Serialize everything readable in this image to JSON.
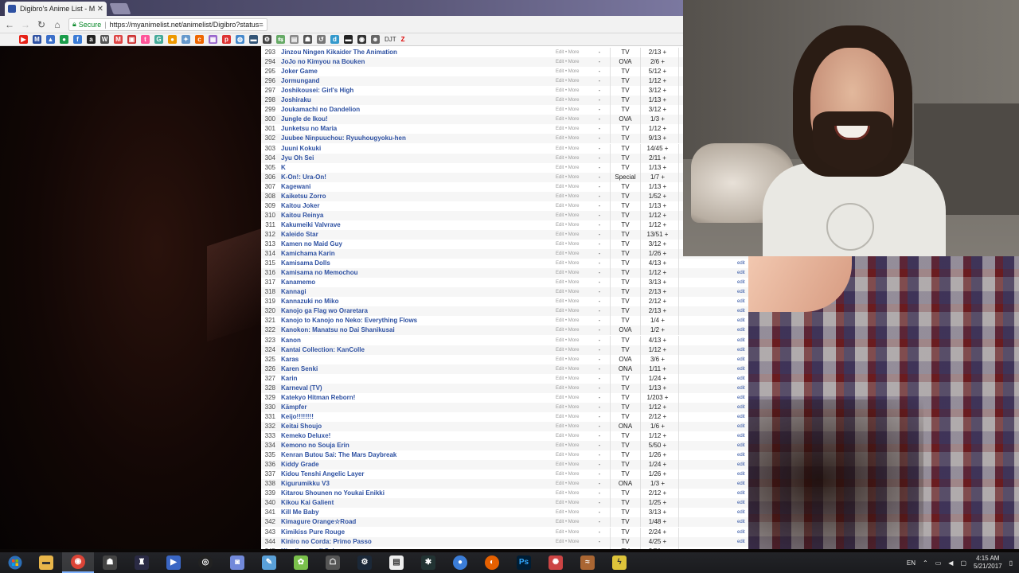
{
  "browser": {
    "tab_title": "Digibro's Anime List - M",
    "secure_label": "Secure",
    "url": "https://myanimelist.net/animelist/Digibro?status=4&tag="
  },
  "bookmarks": {
    "djt": "DJT",
    "z": "Z"
  },
  "list": {
    "edit_more": "Edit • More",
    "edit": "edit",
    "rows": [
      {
        "num": "293",
        "title": "Jinzou Ningen Kikaider The Animation",
        "score": "-",
        "type": "TV",
        "progress": "2/13 +"
      },
      {
        "num": "294",
        "title": "JoJo no Kimyou na Bouken",
        "score": "-",
        "type": "OVA",
        "progress": "2/6 +"
      },
      {
        "num": "295",
        "title": "Joker Game",
        "score": "-",
        "type": "TV",
        "progress": "5/12 +"
      },
      {
        "num": "296",
        "title": "Jormungand",
        "score": "-",
        "type": "TV",
        "progress": "1/12 +"
      },
      {
        "num": "297",
        "title": "Joshikousei: Girl's High",
        "score": "-",
        "type": "TV",
        "progress": "3/12 +"
      },
      {
        "num": "298",
        "title": "Joshiraku",
        "score": "-",
        "type": "TV",
        "progress": "1/13 +"
      },
      {
        "num": "299",
        "title": "Joukamachi no Dandelion",
        "score": "-",
        "type": "TV",
        "progress": "3/12 +"
      },
      {
        "num": "300",
        "title": "Jungle de Ikou!",
        "score": "-",
        "type": "OVA",
        "progress": "1/3 +"
      },
      {
        "num": "301",
        "title": "Junketsu no Maria",
        "score": "-",
        "type": "TV",
        "progress": "1/12 +"
      },
      {
        "num": "302",
        "title": "Juubee Ninpuuchou: Ryuuhougyoku-hen",
        "score": "-",
        "type": "TV",
        "progress": "9/13 +"
      },
      {
        "num": "303",
        "title": "Juuni Kokuki",
        "score": "-",
        "type": "TV",
        "progress": "14/45 +"
      },
      {
        "num": "304",
        "title": "Jyu Oh Sei",
        "score": "-",
        "type": "TV",
        "progress": "2/11 +"
      },
      {
        "num": "305",
        "title": "K",
        "score": "-",
        "type": "TV",
        "progress": "1/13 +"
      },
      {
        "num": "306",
        "title": "K-On!: Ura-On!",
        "score": "-",
        "type": "Special",
        "progress": "1/7 +"
      },
      {
        "num": "307",
        "title": "Kagewani",
        "score": "-",
        "type": "TV",
        "progress": "1/13 +"
      },
      {
        "num": "308",
        "title": "Kaiketsu Zorro",
        "score": "-",
        "type": "TV",
        "progress": "1/52 +"
      },
      {
        "num": "309",
        "title": "Kaitou Joker",
        "score": "-",
        "type": "TV",
        "progress": "1/13 +"
      },
      {
        "num": "310",
        "title": "Kaitou Reinya",
        "score": "-",
        "type": "TV",
        "progress": "1/12 +"
      },
      {
        "num": "311",
        "title": "Kakumeiki Valvrave",
        "score": "-",
        "type": "TV",
        "progress": "1/12 +"
      },
      {
        "num": "312",
        "title": "Kaleido Star",
        "score": "-",
        "type": "TV",
        "progress": "13/51 +"
      },
      {
        "num": "313",
        "title": "Kamen no Maid Guy",
        "score": "-",
        "type": "TV",
        "progress": "3/12 +"
      },
      {
        "num": "314",
        "title": "Kamichama Karin",
        "score": "-",
        "type": "TV",
        "progress": "1/26 +"
      },
      {
        "num": "315",
        "title": "Kamisama Dolls",
        "score": "-",
        "type": "TV",
        "progress": "4/13 +"
      },
      {
        "num": "316",
        "title": "Kamisama no Memochou",
        "score": "-",
        "type": "TV",
        "progress": "1/12 +"
      },
      {
        "num": "317",
        "title": "Kanamemo",
        "score": "-",
        "type": "TV",
        "progress": "3/13 +"
      },
      {
        "num": "318",
        "title": "Kannagi",
        "score": "-",
        "type": "TV",
        "progress": "2/13 +"
      },
      {
        "num": "319",
        "title": "Kannazuki no Miko",
        "score": "-",
        "type": "TV",
        "progress": "2/12 +"
      },
      {
        "num": "320",
        "title": "Kanojo ga Flag wo Oraretara",
        "score": "-",
        "type": "TV",
        "progress": "2/13 +"
      },
      {
        "num": "321",
        "title": "Kanojo to Kanojo no Neko: Everything Flows",
        "score": "-",
        "type": "TV",
        "progress": "1/4 +"
      },
      {
        "num": "322",
        "title": "Kanokon: Manatsu no Dai Shanikusai",
        "score": "-",
        "type": "OVA",
        "progress": "1/2 +"
      },
      {
        "num": "323",
        "title": "Kanon",
        "score": "-",
        "type": "TV",
        "progress": "4/13 +"
      },
      {
        "num": "324",
        "title": "Kantai Collection: KanColle",
        "score": "-",
        "type": "TV",
        "progress": "1/12 +"
      },
      {
        "num": "325",
        "title": "Karas",
        "score": "-",
        "type": "OVA",
        "progress": "3/6 +"
      },
      {
        "num": "326",
        "title": "Karen Senki",
        "score": "-",
        "type": "ONA",
        "progress": "1/11 +"
      },
      {
        "num": "327",
        "title": "Karin",
        "score": "-",
        "type": "TV",
        "progress": "1/24 +"
      },
      {
        "num": "328",
        "title": "Karneval (TV)",
        "score": "-",
        "type": "TV",
        "progress": "1/13 +"
      },
      {
        "num": "329",
        "title": "Katekyo Hitman Reborn!",
        "score": "-",
        "type": "TV",
        "progress": "1/203 +"
      },
      {
        "num": "330",
        "title": "Kämpfer",
        "score": "-",
        "type": "TV",
        "progress": "1/12 +"
      },
      {
        "num": "331",
        "title": "Keijo!!!!!!!!",
        "score": "-",
        "type": "TV",
        "progress": "2/12 +"
      },
      {
        "num": "332",
        "title": "Keitai Shoujo",
        "score": "-",
        "type": "ONA",
        "progress": "1/6 +"
      },
      {
        "num": "333",
        "title": "Kemeko Deluxe!",
        "score": "-",
        "type": "TV",
        "progress": "1/12 +"
      },
      {
        "num": "334",
        "title": "Kemono no Souja Erin",
        "score": "-",
        "type": "TV",
        "progress": "5/50 +"
      },
      {
        "num": "335",
        "title": "Kenran Butou Sai: The Mars Daybreak",
        "score": "-",
        "type": "TV",
        "progress": "1/26 +"
      },
      {
        "num": "336",
        "title": "Kiddy Grade",
        "score": "-",
        "type": "TV",
        "progress": "1/24 +"
      },
      {
        "num": "337",
        "title": "Kidou Tenshi Angelic Layer",
        "score": "-",
        "type": "TV",
        "progress": "1/26 +"
      },
      {
        "num": "338",
        "title": "Kigurumikku V3",
        "score": "-",
        "type": "ONA",
        "progress": "1/3 +"
      },
      {
        "num": "339",
        "title": "Kitarou Shounen no Youkai Enikki",
        "score": "-",
        "type": "TV",
        "progress": "2/12 +"
      },
      {
        "num": "340",
        "title": "Kikou Kai Galient",
        "score": "-",
        "type": "TV",
        "progress": "1/25 +"
      },
      {
        "num": "341",
        "title": "Kill Me Baby",
        "score": "-",
        "type": "TV",
        "progress": "3/13 +"
      },
      {
        "num": "342",
        "title": "Kimagure Orange☆Road",
        "score": "-",
        "type": "TV",
        "progress": "1/48 +"
      },
      {
        "num": "343",
        "title": "Kimikiss Pure Rouge",
        "score": "-",
        "type": "TV",
        "progress": "2/24 +"
      },
      {
        "num": "344",
        "title": "Kiniro no Corda: Primo Passo",
        "score": "-",
        "type": "TV",
        "progress": "4/25 +"
      },
      {
        "num": "345",
        "title": "Kinnikuman II Sei",
        "score": "-",
        "type": "TV",
        "progress": "2/51 +"
      }
    ]
  },
  "taskbar": {
    "lang": "EN",
    "time": "4:15 AM",
    "date": "5/21/2017"
  }
}
